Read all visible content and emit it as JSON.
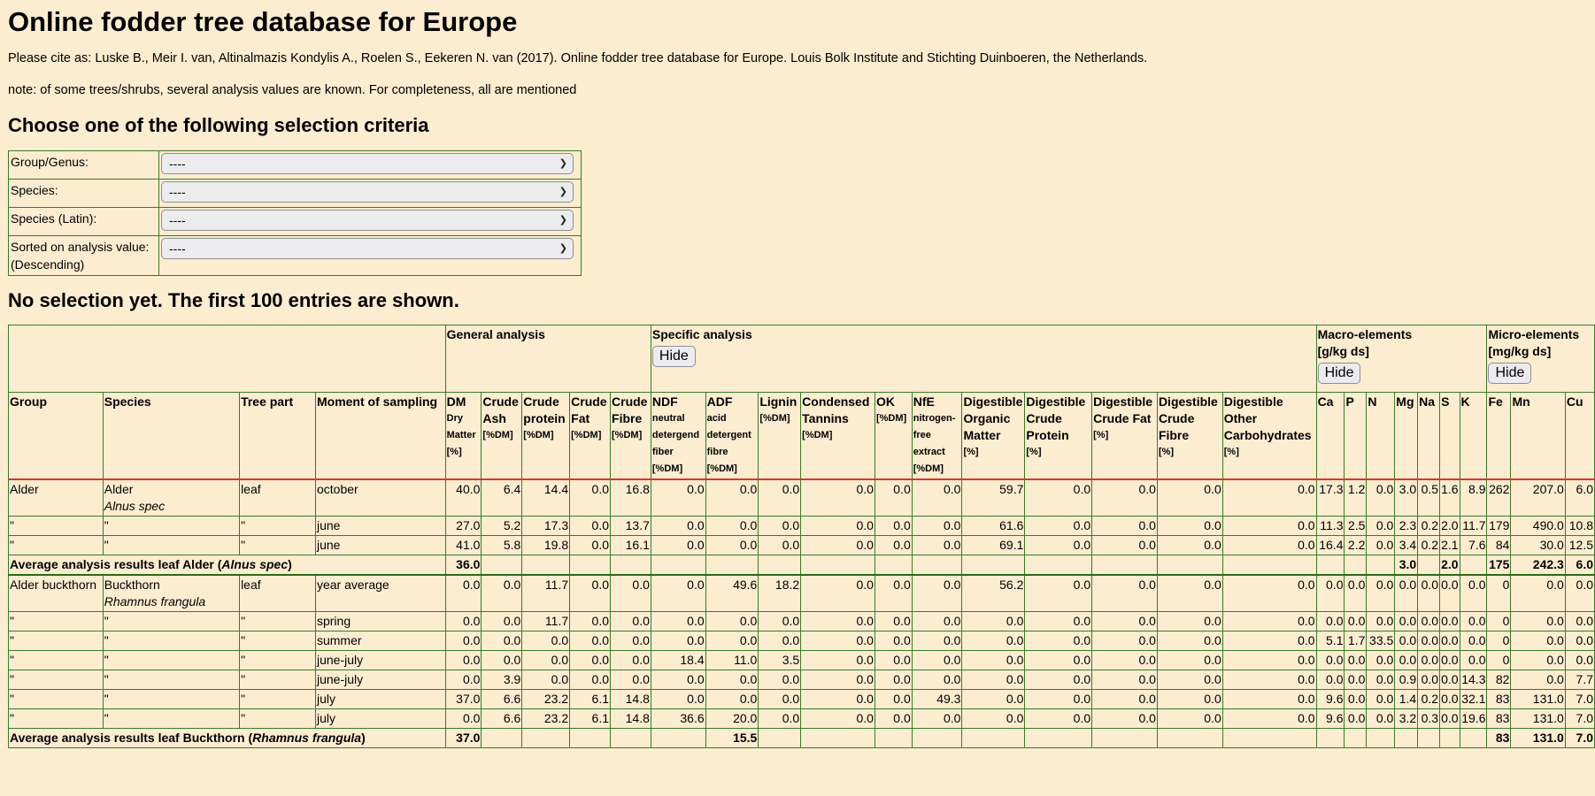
{
  "page": {
    "title": "Online fodder tree database for Europe",
    "cite": "Please cite as: Luske B., Meir I. van, Altinalmazis Kondylis A., Roelen S., Eekeren N. van (2017). Online fodder tree database for Europe. Louis Bolk Institute and Stichting Duinboeren, the Netherlands.",
    "note": "note: of some trees/shrubs, several analysis values are known. For completeness, all are mentioned",
    "criteria_heading": "Choose one of the following selection criteria",
    "no_selection": "No selection yet. The first 100 entries are shown."
  },
  "criteria": [
    {
      "label": "Group/Genus:",
      "value": "----"
    },
    {
      "label": "Species:",
      "value": "----"
    },
    {
      "label": "Species (Latin):",
      "value": "----"
    },
    {
      "label": "Sorted on analysis value: (Descending)",
      "value": "----"
    }
  ],
  "groups": {
    "general": "General analysis",
    "specific": "Specific analysis",
    "macro": "Macro-elements",
    "macro_unit": "[g/kg ds]",
    "micro": "Micro-elements",
    "micro_unit": "[mg/kg ds]",
    "hide": "Hide"
  },
  "headers": {
    "group": "Group",
    "species": "Species",
    "part": "Tree part",
    "moment": "Moment of sampling",
    "dm": "DM",
    "dm_sub": "Dry Matter [%]",
    "ash": "Crude Ash",
    "ash_sub": "[%DM]",
    "prot": "Crude protein",
    "prot_sub": "[%DM]",
    "fat": "Crude Fat",
    "fat_sub": "[%DM]",
    "fibre": "Crude Fibre",
    "fibre_sub": "[%DM]",
    "ndf": "NDF",
    "ndf_sub": "neutral detergend fiber [%DM]",
    "adf": "ADF",
    "adf_sub": "acid detergent fibre [%DM]",
    "lignin": "Lignin",
    "lignin_sub": "[%DM]",
    "tannin": "Condensed Tannins",
    "tannin_sub": "[%DM]",
    "ok": "OK",
    "ok_sub": "[%DM]",
    "nfe": "NfE",
    "nfe_sub": "nitrogen-free extract [%DM]",
    "dom": "Digestible Organic Matter",
    "dom_sub": "[%]",
    "dcp": "Digestible Crude Protein",
    "dcp_sub": "[%]",
    "dcf": "Digestible Crude Fat",
    "dcf_sub": "[%]",
    "dcfi": "Digestible Crude Fibre",
    "dcfi_sub": "[%]",
    "doc": "Digestible Other Carbohydrates",
    "doc_sub": "[%]",
    "ca": "Ca",
    "p": "P",
    "n": "N",
    "mg": "Mg",
    "na": "Na",
    "s": "S",
    "k": "K",
    "fe": "Fe",
    "mn": "Mn",
    "cu": "Cu"
  },
  "rows": [
    {
      "type": "first",
      "group": "Alder",
      "species": "Alder",
      "latin": "Alnus spec",
      "part": "leaf",
      "moment": "october",
      "v": [
        "40.0",
        "6.4",
        "14.4",
        "0.0",
        "16.8",
        "0.0",
        "0.0",
        "0.0",
        "0.0",
        "0.0",
        "0.0",
        "59.7",
        "0.0",
        "0.0",
        "0.0",
        "0.0",
        "17.3",
        "1.2",
        "0.0",
        "3.0",
        "0.5",
        "1.6",
        "8.9",
        "262",
        "207.0",
        "6.0"
      ]
    },
    {
      "type": "row",
      "group": "\"",
      "species": "\"",
      "latin": "",
      "part": "\"",
      "moment": "june",
      "v": [
        "27.0",
        "5.2",
        "17.3",
        "0.0",
        "13.7",
        "0.0",
        "0.0",
        "0.0",
        "0.0",
        "0.0",
        "0.0",
        "61.6",
        "0.0",
        "0.0",
        "0.0",
        "0.0",
        "11.3",
        "2.5",
        "0.0",
        "2.3",
        "0.2",
        "2.0",
        "11.7",
        "179",
        "490.0",
        "10.8"
      ]
    },
    {
      "type": "row",
      "group": "\"",
      "species": "\"",
      "latin": "",
      "part": "\"",
      "moment": "june",
      "v": [
        "41.0",
        "5.8",
        "19.8",
        "0.0",
        "16.1",
        "0.0",
        "0.0",
        "0.0",
        "0.0",
        "0.0",
        "0.0",
        "69.1",
        "0.0",
        "0.0",
        "0.0",
        "0.0",
        "16.4",
        "2.2",
        "0.0",
        "3.4",
        "0.2",
        "2.1",
        "7.6",
        "84",
        "30.0",
        "12.5"
      ]
    },
    {
      "type": "avg",
      "label": "Average analysis results leaf Alder (",
      "latin": "Alnus spec",
      "close": ")",
      "v": [
        "36.0",
        "",
        "",
        "",
        "",
        "",
        "",
        "",
        "",
        "",
        "",
        "",
        "",
        "",
        "",
        "",
        "",
        "",
        "",
        "3.0",
        "",
        "2.0",
        "",
        "175",
        "242.3",
        "6.0"
      ]
    },
    {
      "type": "group",
      "group": "Alder buckthorn",
      "species": "Buckthorn",
      "latin": "Rhamnus frangula",
      "part": "leaf",
      "moment": "year average",
      "v": [
        "0.0",
        "0.0",
        "11.7",
        "0.0",
        "0.0",
        "0.0",
        "49.6",
        "18.2",
        "0.0",
        "0.0",
        "0.0",
        "56.2",
        "0.0",
        "0.0",
        "0.0",
        "0.0",
        "0.0",
        "0.0",
        "0.0",
        "0.0",
        "0.0",
        "0.0",
        "0.0",
        "0",
        "0.0",
        "0.0"
      ]
    },
    {
      "type": "row",
      "group": "\"",
      "species": "\"",
      "latin": "",
      "part": "\"",
      "moment": "spring",
      "v": [
        "0.0",
        "0.0",
        "11.7",
        "0.0",
        "0.0",
        "0.0",
        "0.0",
        "0.0",
        "0.0",
        "0.0",
        "0.0",
        "0.0",
        "0.0",
        "0.0",
        "0.0",
        "0.0",
        "0.0",
        "0.0",
        "0.0",
        "0.0",
        "0.0",
        "0.0",
        "0.0",
        "0",
        "0.0",
        "0.0"
      ]
    },
    {
      "type": "row",
      "group": "\"",
      "species": "\"",
      "latin": "",
      "part": "\"",
      "moment": "summer",
      "v": [
        "0.0",
        "0.0",
        "0.0",
        "0.0",
        "0.0",
        "0.0",
        "0.0",
        "0.0",
        "0.0",
        "0.0",
        "0.0",
        "0.0",
        "0.0",
        "0.0",
        "0.0",
        "0.0",
        "5.1",
        "1.7",
        "33.5",
        "0.0",
        "0.0",
        "0.0",
        "0.0",
        "0",
        "0.0",
        "0.0"
      ]
    },
    {
      "type": "row",
      "group": "\"",
      "species": "\"",
      "latin": "",
      "part": "\"",
      "moment": "june-july",
      "v": [
        "0.0",
        "0.0",
        "0.0",
        "0.0",
        "0.0",
        "18.4",
        "11.0",
        "3.5",
        "0.0",
        "0.0",
        "0.0",
        "0.0",
        "0.0",
        "0.0",
        "0.0",
        "0.0",
        "0.0",
        "0.0",
        "0.0",
        "0.0",
        "0.0",
        "0.0",
        "0.0",
        "0",
        "0.0",
        "0.0"
      ]
    },
    {
      "type": "row",
      "group": "\"",
      "species": "\"",
      "latin": "",
      "part": "\"",
      "moment": "june-july",
      "v": [
        "0.0",
        "3.9",
        "0.0",
        "0.0",
        "0.0",
        "0.0",
        "0.0",
        "0.0",
        "0.0",
        "0.0",
        "0.0",
        "0.0",
        "0.0",
        "0.0",
        "0.0",
        "0.0",
        "0.0",
        "0.0",
        "0.0",
        "0.9",
        "0.0",
        "0.0",
        "14.3",
        "82",
        "0.0",
        "7.7"
      ]
    },
    {
      "type": "row",
      "group": "\"",
      "species": "\"",
      "latin": "",
      "part": "\"",
      "moment": "july",
      "v": [
        "37.0",
        "6.6",
        "23.2",
        "6.1",
        "14.8",
        "0.0",
        "0.0",
        "0.0",
        "0.0",
        "0.0",
        "49.3",
        "0.0",
        "0.0",
        "0.0",
        "0.0",
        "0.0",
        "9.6",
        "0.0",
        "0.0",
        "1.4",
        "0.2",
        "0.0",
        "32.1",
        "83",
        "131.0",
        "7.0"
      ]
    },
    {
      "type": "row",
      "group": "\"",
      "species": "\"",
      "latin": "",
      "part": "\"",
      "moment": "july",
      "v": [
        "0.0",
        "6.6",
        "23.2",
        "6.1",
        "14.8",
        "36.6",
        "20.0",
        "0.0",
        "0.0",
        "0.0",
        "0.0",
        "0.0",
        "0.0",
        "0.0",
        "0.0",
        "0.0",
        "9.6",
        "0.0",
        "0.0",
        "3.2",
        "0.3",
        "0.0",
        "19.6",
        "83",
        "131.0",
        "7.0"
      ]
    },
    {
      "type": "avg",
      "label": "Average analysis results leaf Buckthorn (",
      "latin": "Rhamnus frangula",
      "close": ")",
      "v": [
        "37.0",
        "",
        "",
        "",
        "",
        "",
        "15.5",
        "",
        "",
        "",
        "",
        "",
        "",
        "",
        "",
        "",
        "",
        "",
        "",
        "",
        "",
        "",
        "",
        "83",
        "131.0",
        "7.0"
      ]
    }
  ]
}
